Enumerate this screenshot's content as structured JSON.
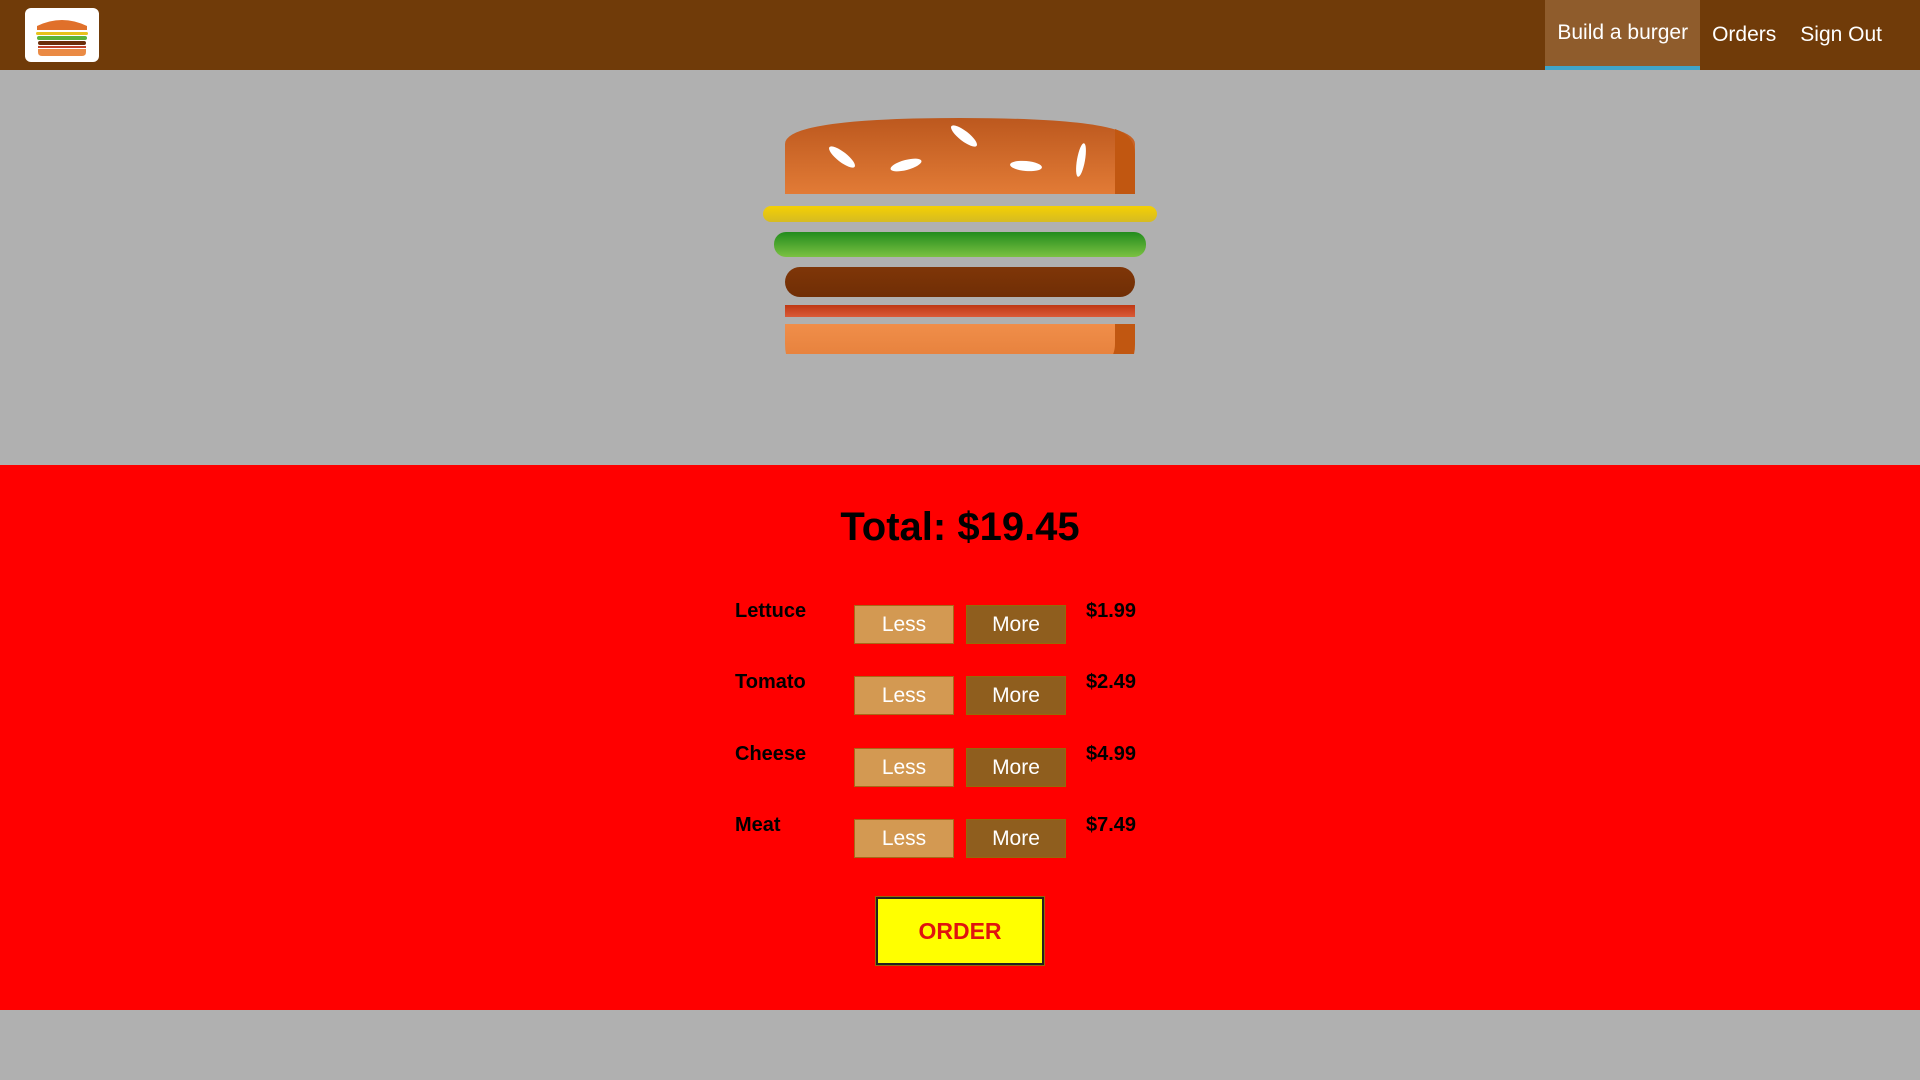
{
  "header": {
    "logo_icon": "burger-logo-icon",
    "nav": [
      {
        "label": "Build a burger",
        "active": true
      },
      {
        "label": "Orders",
        "active": false
      },
      {
        "label": "Sign Out",
        "active": false
      }
    ]
  },
  "burger_preview": {
    "layers": [
      "bread-top",
      "cheese",
      "salad",
      "meat",
      "bacon",
      "bread-bottom"
    ]
  },
  "build_controls": {
    "total_text": "Total: $19.45",
    "less_label": "Less",
    "more_label": "More",
    "ingredients": [
      {
        "name": "Lettuce",
        "price": "$1.99"
      },
      {
        "name": "Tomato",
        "price": "$2.49"
      },
      {
        "name": "Cheese",
        "price": "$4.99"
      },
      {
        "name": "Meat",
        "price": "$7.49"
      }
    ],
    "order_label": "ORDER"
  },
  "colors": {
    "toolbar": "#703b09",
    "page_bg": "#b0b0b0",
    "controls_bg": "#ff0000",
    "less_button": "#d39952",
    "more_button": "#8f5e1e",
    "order_button": "#ffff00",
    "order_text": "#e0130f"
  }
}
